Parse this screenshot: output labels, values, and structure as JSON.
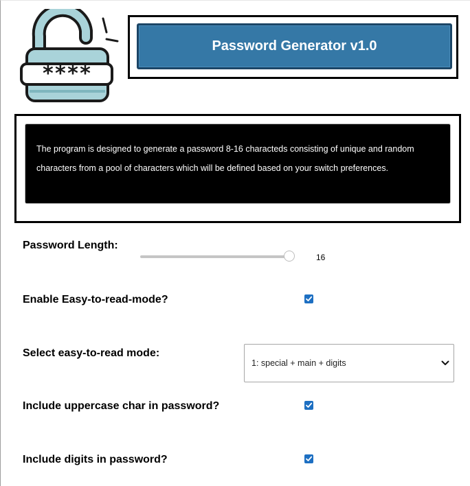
{
  "header": {
    "title": "Password Generator v1.0",
    "logo_mask_text": "****"
  },
  "description": {
    "line1": "The program is designed to generate a password 8-16 characteds consisting of unique and random",
    "line2": "characters from a pool of characters which will be defined based on your switch preferences."
  },
  "settings": {
    "password_length": {
      "label": "Password Length:",
      "value": "16",
      "min": 8,
      "max": 16
    },
    "easy_to_read": {
      "label": "Enable Easy-to-read-mode?",
      "checked": true
    },
    "easy_mode_select": {
      "label": "Select easy-to-read mode:",
      "selected": "1: special + main + digits"
    },
    "uppercase": {
      "label": "Include uppercase char in password?",
      "checked": true
    },
    "digits": {
      "label": "Include digits in password?",
      "checked": true
    }
  },
  "colors": {
    "accent": "#3578a6",
    "checkbox": "#1d6fc2",
    "logo_teal": "#a9d3d9"
  },
  "icons": {
    "logo": "padlock-password-icon",
    "checkmark": "checkmark-icon",
    "dropdown": "chevron-down-icon"
  }
}
